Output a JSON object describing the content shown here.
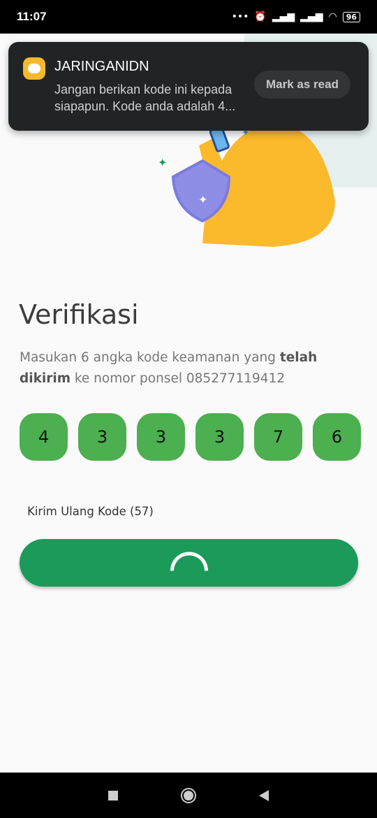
{
  "status_bar": {
    "time": "11:07",
    "battery": "96"
  },
  "notification": {
    "app": "JARINGANIDN",
    "message": "Jangan berikan kode ini kepada siapapun. Kode anda adalah 4...",
    "action": "Mark as read"
  },
  "page": {
    "title": "Verifikasi",
    "desc_pre": "Masukan 6 angka kode keamanan yang ",
    "desc_bold": "telah dikirim",
    "desc_post": " ke nomor ponsel 085277119412",
    "otp": [
      "4",
      "3",
      "3",
      "3",
      "7",
      "6"
    ],
    "resend": "Kirim Ulang Kode (57)"
  },
  "colors": {
    "primary": "#1b9a59",
    "otp_box": "#4caf50",
    "accent": "#f6b92b"
  }
}
